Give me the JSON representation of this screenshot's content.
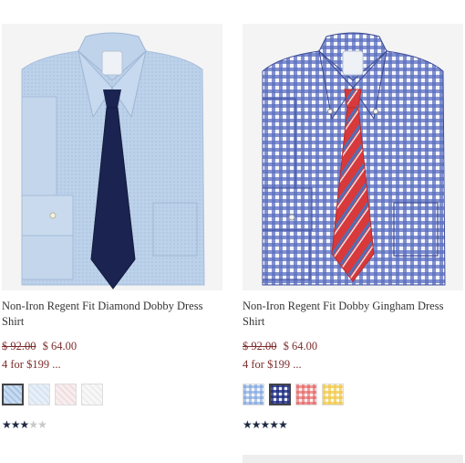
{
  "products": [
    {
      "name": "Non-Iron Regent Fit Diamond Dobby Dress Shirt",
      "original_price": "$ 92.00",
      "sale_price": "$ 64.00",
      "promo": "4 for $199 ...",
      "rating": 3,
      "rating_max": 5,
      "swatch_count": 4
    },
    {
      "name": "Non-Iron Regent Fit Dobby Gingham Dress Shirt",
      "original_price": "$ 92.00",
      "sale_price": "$ 64.00",
      "promo": "4 for $199 ...",
      "rating": 5,
      "rating_max": 5,
      "swatch_count": 4
    }
  ]
}
